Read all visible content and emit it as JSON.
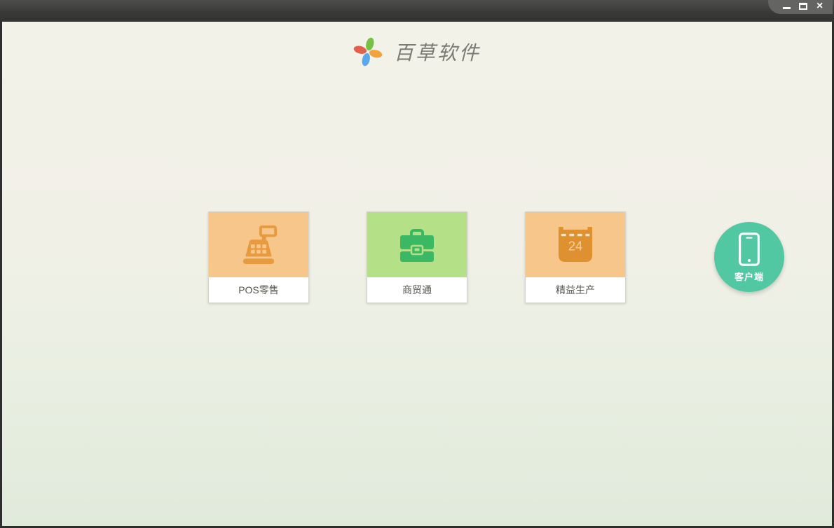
{
  "window": {
    "controls": {
      "minimize": "minimize",
      "maximize": "maximize",
      "close_glyph": "×"
    }
  },
  "header": {
    "app_name": "百草软件"
  },
  "products": [
    {
      "label": "POS零售",
      "icon": "cash-register-icon",
      "bg_color": "#f7c68b",
      "icon_color": "#e89a3e"
    },
    {
      "label": "商贸通",
      "icon": "briefcase-icon",
      "bg_color": "#b4e187",
      "icon_color": "#3bb863"
    },
    {
      "label": "精益生产",
      "icon": "calendar-icon",
      "bg_color": "#f7c68b",
      "icon_color": "#e0912f",
      "calendar_day": "24"
    }
  ],
  "client_button": {
    "label": "客户端",
    "icon": "smartphone-icon",
    "bg_color": "#52c8a2"
  },
  "colors": {
    "titlebar_top": "#4e4e4c",
    "titlebar_bottom": "#323230",
    "frame_border": "#2e2e2c",
    "control_wedge": "#646462",
    "content_gradient_top": "#f3f2e9",
    "content_gradient_bottom": "#e0eadb",
    "card_label_text": "#57564f",
    "app_title_text": "#7b7b73",
    "calendar_number_text": "#f2cf9d",
    "logo_petals": {
      "top": "#76c043",
      "right": "#f2a33c",
      "bottom": "#58a9ee",
      "left": "#e2614d"
    }
  }
}
